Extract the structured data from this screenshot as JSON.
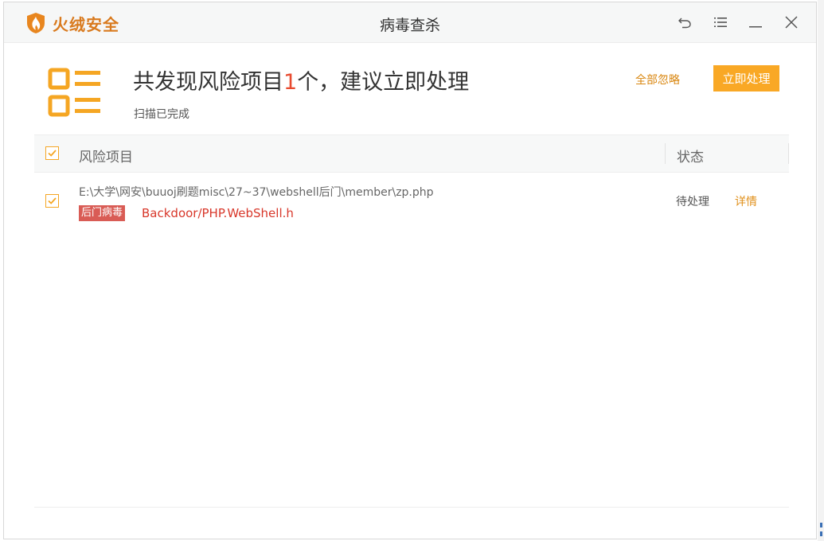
{
  "app": {
    "brand": "火绒安全",
    "title": "病毒查杀"
  },
  "summary": {
    "headline_prefix": "共发现风险项目",
    "count": "1",
    "headline_suffix": "个，建议立即处理",
    "status_text": "扫描已完成"
  },
  "actions": {
    "ignore_all": "全部忽略",
    "handle_now": "立即处理"
  },
  "table": {
    "col_risk": "风险项目",
    "col_status": "状态",
    "rows": [
      {
        "path": "E:\\大学\\网安\\buuoj刷题misc\\27~37\\webshell后门\\member\\zp.php",
        "tag": "后门病毒",
        "virus_name": "Backdoor/PHP.WebShell.h",
        "status": "待处理",
        "detail": "详情"
      }
    ]
  },
  "colors": {
    "accent": "#f9a825",
    "brand": "#d97a1e",
    "danger": "#e84b2f",
    "tag_bg": "#d95c55"
  },
  "icons": [
    "fire-shield-logo-icon",
    "back-icon",
    "menu-icon",
    "minimize-icon",
    "close-icon",
    "risk-list-icon",
    "checkbox-checked-icon"
  ]
}
